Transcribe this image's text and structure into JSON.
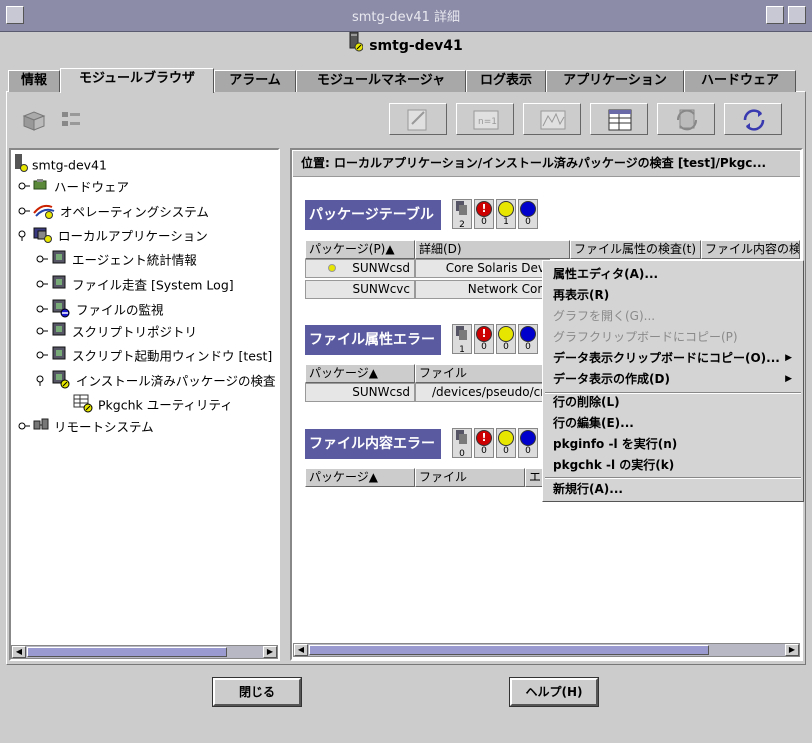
{
  "window": {
    "title": "smtg-dev41 詳細",
    "host": "smtg-dev41"
  },
  "tabs": [
    {
      "label": "情報"
    },
    {
      "label": "モジュールブラウザ"
    },
    {
      "label": "アラーム"
    },
    {
      "label": "モジュールマネージャ"
    },
    {
      "label": "ログ表示"
    },
    {
      "label": "アプリケーション"
    },
    {
      "label": "ハードウェア"
    }
  ],
  "tree": {
    "root": "smtg-dev41",
    "items": [
      {
        "label": "ハードウェア"
      },
      {
        "label": "オペレーティングシステム"
      },
      {
        "label": "ローカルアプリケーション"
      },
      {
        "label": "エージェント統計情報"
      },
      {
        "label": "ファイル走査 [System Log]"
      },
      {
        "label": "ファイルの監視"
      },
      {
        "label": "スクリプトリポジトリ"
      },
      {
        "label": "スクリプト起動用ウィンドウ [test]"
      },
      {
        "label": "インストール済みパッケージの検査"
      },
      {
        "label": "Pkgchk ユーティリティ"
      },
      {
        "label": "リモートシステム"
      }
    ]
  },
  "location": {
    "text": "位置:  ローカルアプリケーション/インストール済みパッケージの検査 [test]/Pkgc..."
  },
  "sections": {
    "package_table": {
      "title": "パッケージテーブル",
      "counts": [
        "2",
        "0",
        "1",
        "0"
      ],
      "headers": [
        "パッケージ(P)▲",
        "詳細(D)",
        "ファイル属性の検査(t)",
        "ファイル内容の検"
      ],
      "rows": [
        {
          "pkg": "SUNWcsd",
          "detail": "Core Solaris Dev"
        },
        {
          "pkg": "SUNWcvc",
          "detail": "Network Con"
        }
      ]
    },
    "attr_errors": {
      "title": "ファイル属性エラー",
      "counts": [
        "1",
        "0",
        "0",
        "0"
      ],
      "headers": [
        "パッケージ▲",
        "ファイル"
      ],
      "rows": [
        {
          "pkg": "SUNWcsd",
          "file": "/devices/pseudo/cn"
        }
      ]
    },
    "content_errors": {
      "title": "ファイル内容エラー",
      "counts": [
        "0",
        "0",
        "0",
        "0"
      ],
      "headers": [
        "パッケージ▲",
        "ファイル",
        "エ"
      ]
    }
  },
  "context_menu": {
    "items": [
      {
        "label": "属性エディタ(A)...",
        "enabled": true
      },
      {
        "label": "再表示(R)",
        "enabled": true
      },
      {
        "label": "グラフを開く(G)...",
        "enabled": false
      },
      {
        "label": "グラフクリップボードにコピー(P)",
        "enabled": false
      },
      {
        "label": "データ表示クリップボードにコピー(O)...",
        "enabled": true
      },
      {
        "label": "データ表示の作成(D)",
        "enabled": true
      },
      {
        "label": "行の削除(L)",
        "enabled": true
      },
      {
        "label": "行の編集(E)...",
        "enabled": true
      },
      {
        "label": "pkginfo -l を実行(n)",
        "enabled": true
      },
      {
        "label": "pkgchk -l の実行(k)",
        "enabled": true
      },
      {
        "label": "新規行(A)...",
        "enabled": true
      }
    ]
  },
  "buttons": {
    "close": "閉じる",
    "help": "ヘルプ(H)"
  },
  "colors": {
    "titlebar": "#8c8ca8",
    "section_header": "#5a5aa0",
    "alarm_critical": "#cc0000",
    "alarm_major": "#e6e600",
    "alarm_minor": "#0000cc"
  }
}
